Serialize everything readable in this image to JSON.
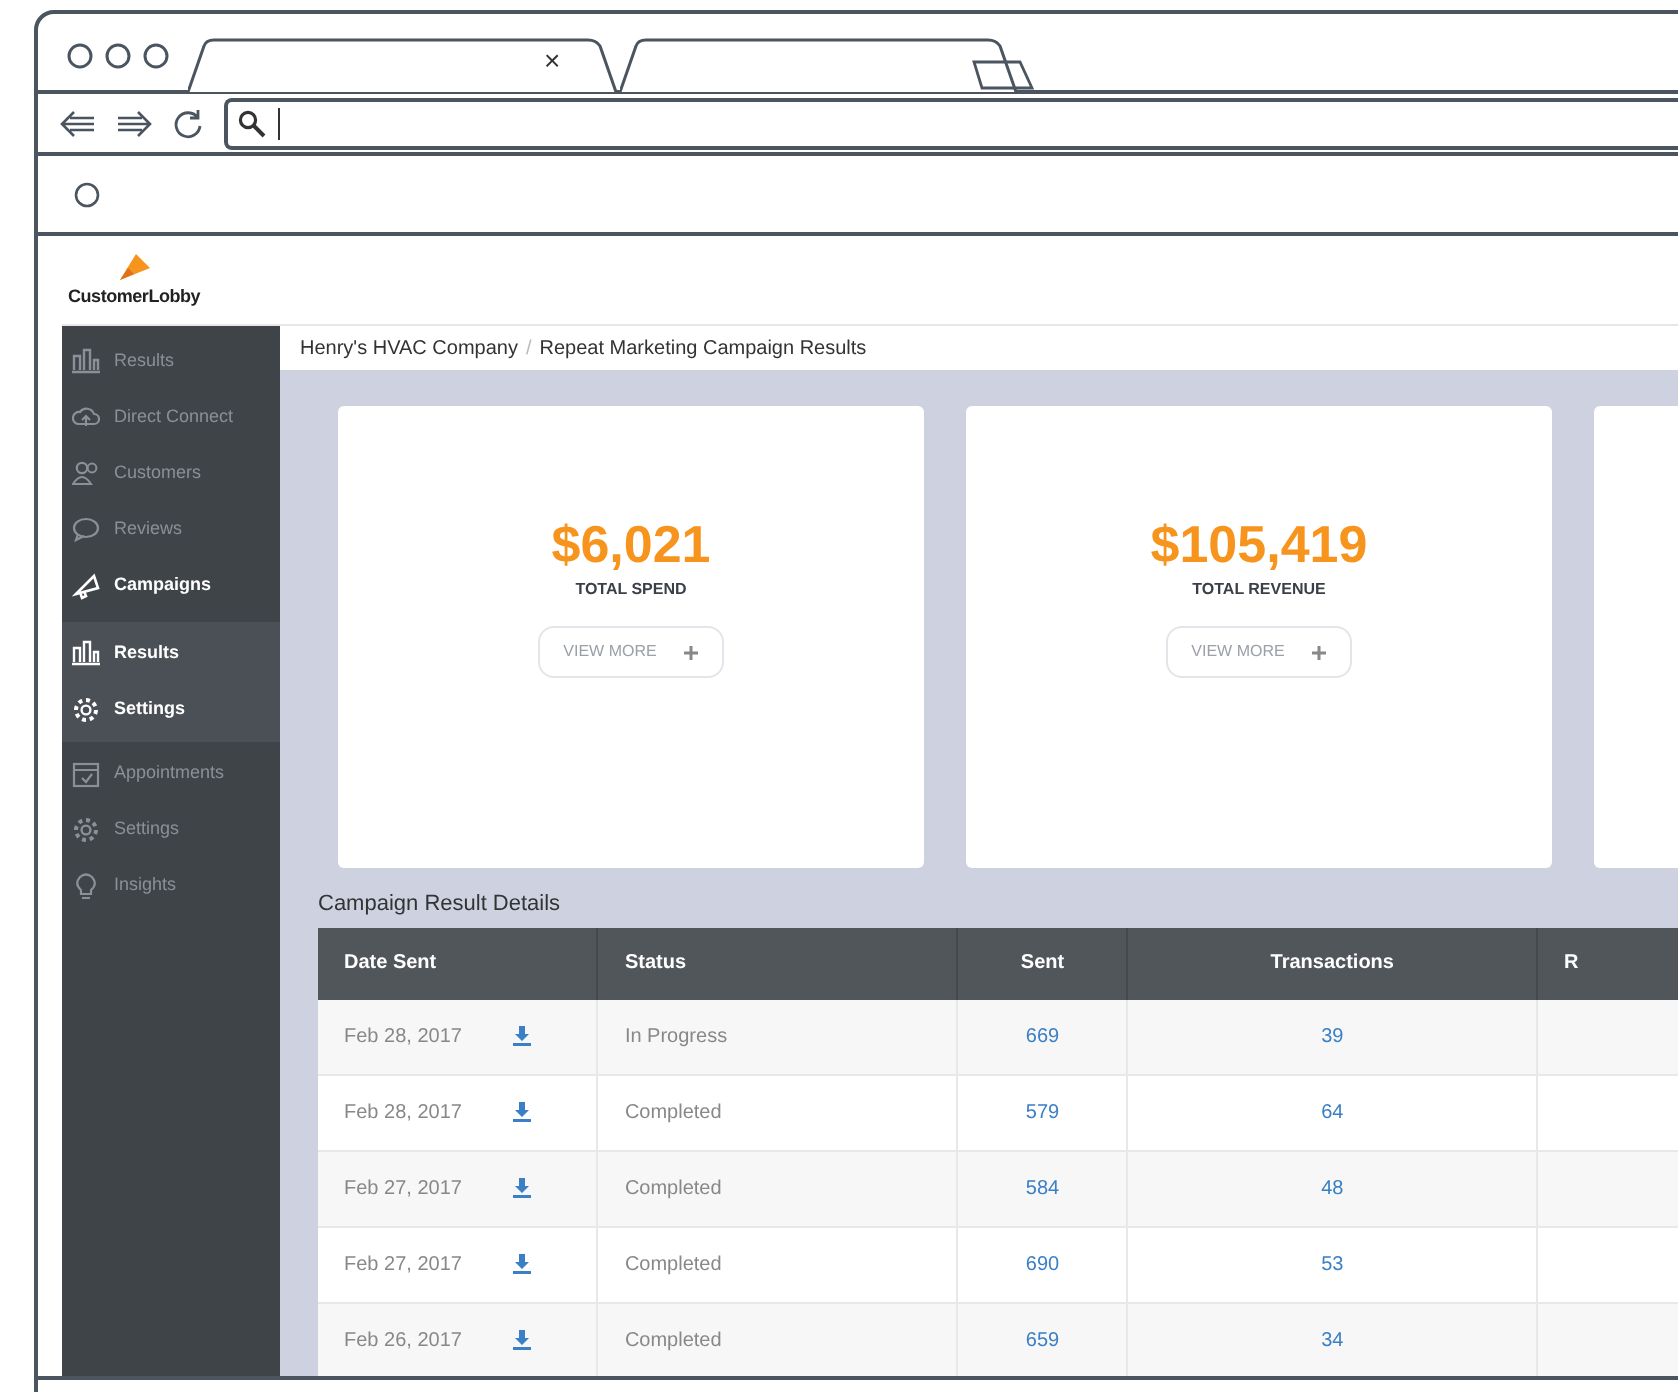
{
  "browser": {
    "tab_close": "×"
  },
  "brand": {
    "name": "CustomerLobby"
  },
  "sidebar": {
    "items": [
      {
        "label": "Results",
        "active": false
      },
      {
        "label": "Direct Connect",
        "active": false
      },
      {
        "label": "Customers",
        "active": false
      },
      {
        "label": "Reviews",
        "active": false
      },
      {
        "label": "Campaigns",
        "active": true,
        "children": [
          {
            "label": "Results",
            "active": true
          },
          {
            "label": "Settings",
            "active": true
          }
        ]
      },
      {
        "label": "Appointments",
        "active": false
      },
      {
        "label": "Settings",
        "active": false
      },
      {
        "label": "Insights",
        "active": false
      }
    ]
  },
  "breadcrumb": {
    "separator": "/",
    "items": [
      "Henry's HVAC Company",
      "Repeat Marketing Campaign Results"
    ]
  },
  "cards": [
    {
      "value": "$6,021",
      "label": "TOTAL SPEND",
      "button": "VIEW MORE"
    },
    {
      "value": "$105,419",
      "label": "TOTAL REVENUE",
      "button": "VIEW MORE"
    }
  ],
  "table": {
    "title": "Campaign Result Details",
    "columns": [
      "Date Sent",
      "Status",
      "Sent",
      "Transactions",
      "R"
    ],
    "rows": [
      {
        "date": "Feb 28, 2017",
        "status": "In Progress",
        "sent": "669",
        "transactions": "39"
      },
      {
        "date": "Feb 28, 2017",
        "status": "Completed",
        "sent": "579",
        "transactions": "64"
      },
      {
        "date": "Feb 27, 2017",
        "status": "Completed",
        "sent": "584",
        "transactions": "48"
      },
      {
        "date": "Feb 27, 2017",
        "status": "Completed",
        "sent": "690",
        "transactions": "53"
      },
      {
        "date": "Feb 26, 2017",
        "status": "Completed",
        "sent": "659",
        "transactions": "34"
      }
    ]
  }
}
